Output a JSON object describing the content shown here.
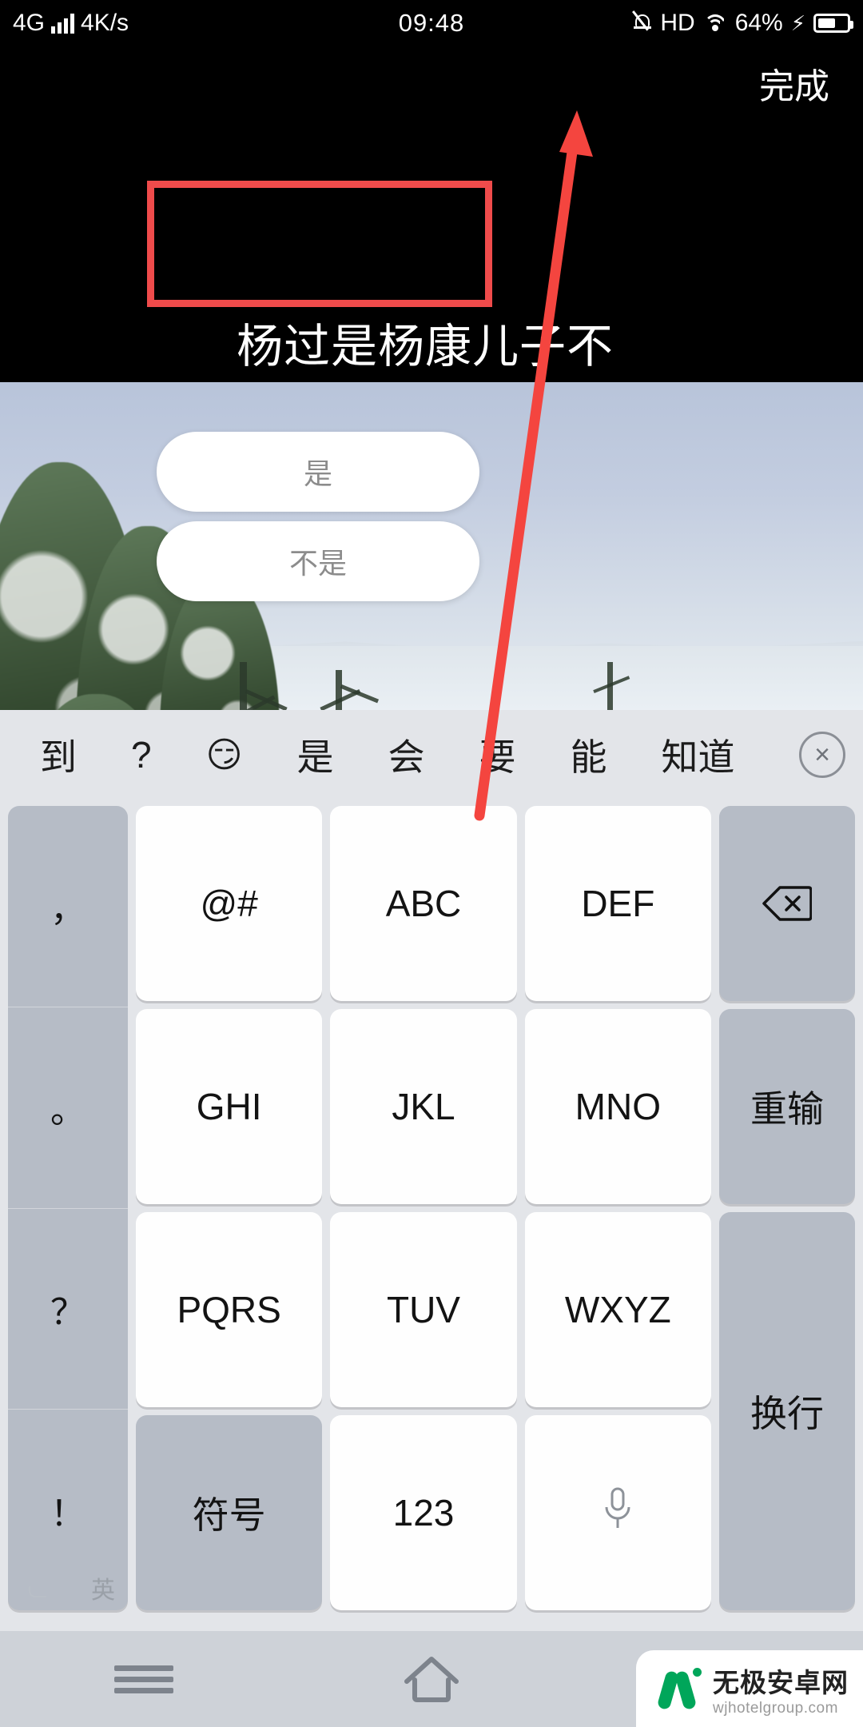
{
  "status_bar": {
    "network_type": "4G",
    "data_rate": "4K/s",
    "time": "09:48",
    "hd_label": "HD",
    "battery_percent": "64%",
    "icons": [
      "signal-bars-icon",
      "bell-muted-icon",
      "wifi-icon",
      "charging-bolt-icon",
      "battery-icon"
    ]
  },
  "top_bar": {
    "done_label": "完成"
  },
  "compose": {
    "text": "杨过是杨康儿子不"
  },
  "poll": {
    "options": [
      {
        "label": "是"
      },
      {
        "label": "不是"
      }
    ]
  },
  "annotation": {
    "box_color": "#ef4b4b",
    "arrow_color": "#f4453f"
  },
  "keyboard": {
    "candidates": [
      {
        "text": "到",
        "type": "word"
      },
      {
        "text": "?",
        "type": "word"
      },
      {
        "text": "😏",
        "type": "emoji"
      },
      {
        "text": "是",
        "type": "word"
      },
      {
        "text": "会",
        "type": "word"
      },
      {
        "text": "要",
        "type": "word"
      },
      {
        "text": "能",
        "type": "word"
      },
      {
        "text": "知道",
        "type": "word"
      }
    ],
    "close_label": "×",
    "punct_column": [
      "，",
      "。",
      "？",
      "！"
    ],
    "rows": [
      {
        "keys": [
          "@#",
          "ABC",
          "DEF"
        ],
        "right": "backspace-icon"
      },
      {
        "keys": [
          "GHI",
          "JKL",
          "MNO"
        ],
        "right": "重输"
      },
      {
        "keys": [
          "PQRS",
          "TUV",
          "WXYZ"
        ],
        "right": "换行"
      }
    ],
    "bottom_row": {
      "symbols": "符号",
      "numbers": "123",
      "mic": "microphone-icon",
      "lang_primary": "中",
      "lang_secondary": "英"
    }
  },
  "nav_bar": {
    "items": [
      "menu-icon",
      "home-icon",
      "back-icon"
    ]
  },
  "watermark": {
    "cn": "无极安卓网",
    "en": "wjhotelgroup.com"
  }
}
